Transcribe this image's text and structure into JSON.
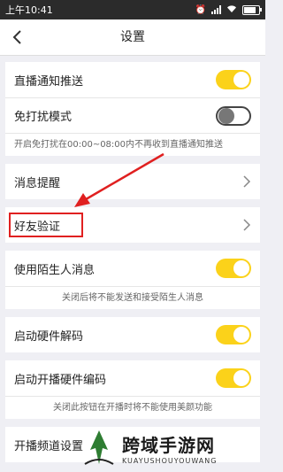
{
  "status_bar": {
    "time": "上午10:41"
  },
  "header": {
    "title": "设置"
  },
  "settings": {
    "live_push": {
      "label": "直播通知推送",
      "state": "on"
    },
    "dnd": {
      "label": "免打扰模式",
      "state": "off",
      "hint": "开启免打扰在00:00~08:00内不再收到直播通知推送"
    },
    "msg_remind": {
      "label": "消息提醒"
    },
    "friend_verify": {
      "label": "好友验证"
    },
    "stranger": {
      "label": "使用陌生人消息",
      "state": "on",
      "hint": "关闭后将不能发送和接受陌生人消息"
    },
    "hw_decode": {
      "label": "启动硬件解码",
      "state": "on"
    },
    "hw_encode": {
      "label": "启动开播硬件编码",
      "state": "on",
      "hint": "关闭此按钮在开播时将不能使用美颜功能"
    },
    "channel": {
      "label": "开播频道设置"
    }
  },
  "watermark": {
    "cn": "跨域手游网",
    "en": "KUAYUSHOUYOUWANG"
  },
  "colors": {
    "toggle_on": "#fbd21a",
    "highlight": "#e02020"
  }
}
